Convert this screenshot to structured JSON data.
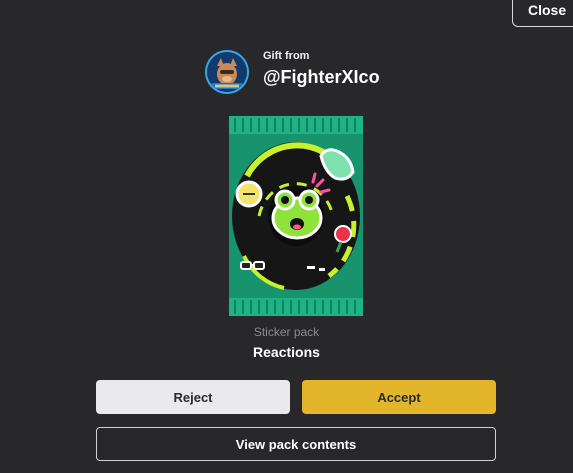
{
  "dialog": {
    "close_label": "Close",
    "sender": {
      "prefix": "Gift from",
      "username": "@FighterXIco",
      "avatar_icon": "avatar-image"
    },
    "pack": {
      "type_label": "Sticker pack",
      "name": "Reactions",
      "art_icon": "sticker-pack-image"
    },
    "actions": {
      "reject_label": "Reject",
      "accept_label": "Accept",
      "view_label": "View pack contents"
    }
  },
  "colors": {
    "background": "#28282a",
    "accept": "#e2b52a",
    "reject": "#eaeaec",
    "pack_green": "#1fa07a",
    "avatar_ring": "#3aa7ea"
  }
}
